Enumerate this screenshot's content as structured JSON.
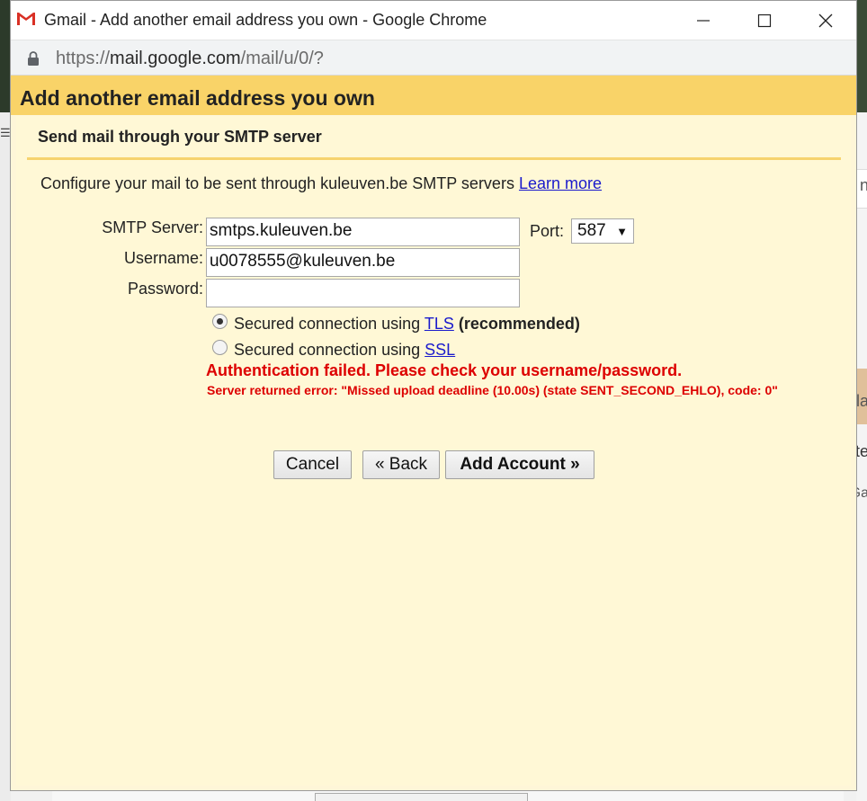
{
  "window": {
    "title": "Gmail - Add another email address you own - Google Chrome",
    "url_scheme": "https://",
    "url_host": "mail.google.com",
    "url_path": "/mail/u/0/?"
  },
  "dialog": {
    "title": "Add another email address you own",
    "section_title": "Send mail through your SMTP server",
    "intro_text": "Configure your mail to be sent through kuleuven.be SMTP servers",
    "learn_more": "Learn more"
  },
  "form": {
    "smtp_label": "SMTP Server:",
    "smtp_value": "smtps.kuleuven.be",
    "port_label": "Port:",
    "port_value": "587",
    "username_label": "Username:",
    "username_value": "u0078555@kuleuven.be",
    "password_label": "Password:",
    "password_value": "",
    "tls_text": "Secured connection using",
    "tls_link": "TLS",
    "tls_recommended": "(recommended)",
    "ssl_text": "Secured connection using",
    "ssl_link": "SSL",
    "selected_security": "TLS"
  },
  "error": {
    "main": "Authentication failed. Please check your username/password.",
    "detail": "Server returned error: \"Missed upload deadline (10.00s) (state SENT_SECOND_EHLO), code: 0\""
  },
  "buttons": {
    "cancel": "Cancel",
    "back": "« Back",
    "add_account": "Add Account »"
  },
  "background_fragments": {
    "right_1": "n",
    "right_2": "la",
    "right_3": "te",
    "right_4": "Ga"
  },
  "colors": {
    "header_bg": "#f9d368",
    "body_bg": "#fff8d6",
    "error": "#dd0000",
    "link": "#1a1acc"
  }
}
